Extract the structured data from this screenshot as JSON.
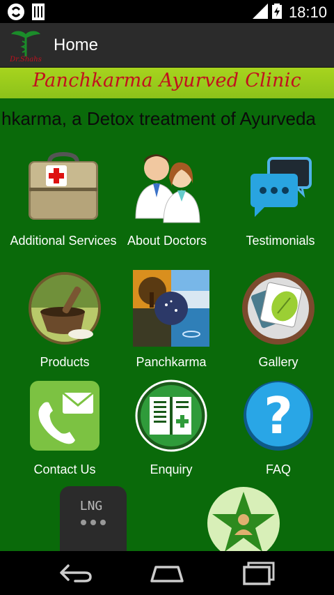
{
  "status_bar": {
    "time": "18:10",
    "icons": [
      "sync-icon",
      "sim-icon",
      "signal-icon",
      "battery-charging-icon"
    ]
  },
  "action_bar": {
    "title": "Home",
    "logo_text": "Dr.Shahs"
  },
  "banner": {
    "text": "Panchkarma Ayurved Clinic"
  },
  "marquee": {
    "text": "hkarma, a Detox treatment of Ayurveda"
  },
  "menu": {
    "additional_services": "Additional Services",
    "about_doctors": "About Doctors",
    "testimonials": "Testimonials",
    "products": "Products",
    "panchkarma": "Panchkarma",
    "gallery": "Gallery",
    "contact_us": "Contact Us",
    "enquiry": "Enquiry",
    "faq": "FAQ"
  },
  "extra_icons": {
    "lng_text": "LNG"
  },
  "navigation": {
    "buttons": [
      "back-icon",
      "home-icon",
      "recent-apps-icon"
    ]
  },
  "colors": {
    "content_bg": "#0a6a0a",
    "banner_bg": "#a7d41e",
    "banner_text": "#c2101e",
    "action_bar": "#2b2b2b"
  }
}
